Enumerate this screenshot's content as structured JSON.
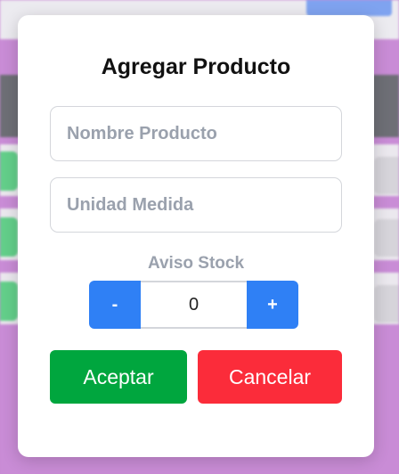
{
  "modal": {
    "title": "Agregar Producto",
    "name_placeholder": "Nombre Producto",
    "name_value": "",
    "unit_placeholder": "Unidad Medida",
    "unit_value": "",
    "stock_label": "Aviso Stock",
    "stepper": {
      "minus_label": "-",
      "value": "0",
      "plus_label": "+"
    },
    "accept_label": "Aceptar",
    "cancel_label": "Cancelar"
  },
  "colors": {
    "overlay": "#c88ad4",
    "primary": "#2f80f5",
    "accept": "#00a63e",
    "cancel": "#fb2c3a",
    "placeholder": "#9aa1ad"
  }
}
